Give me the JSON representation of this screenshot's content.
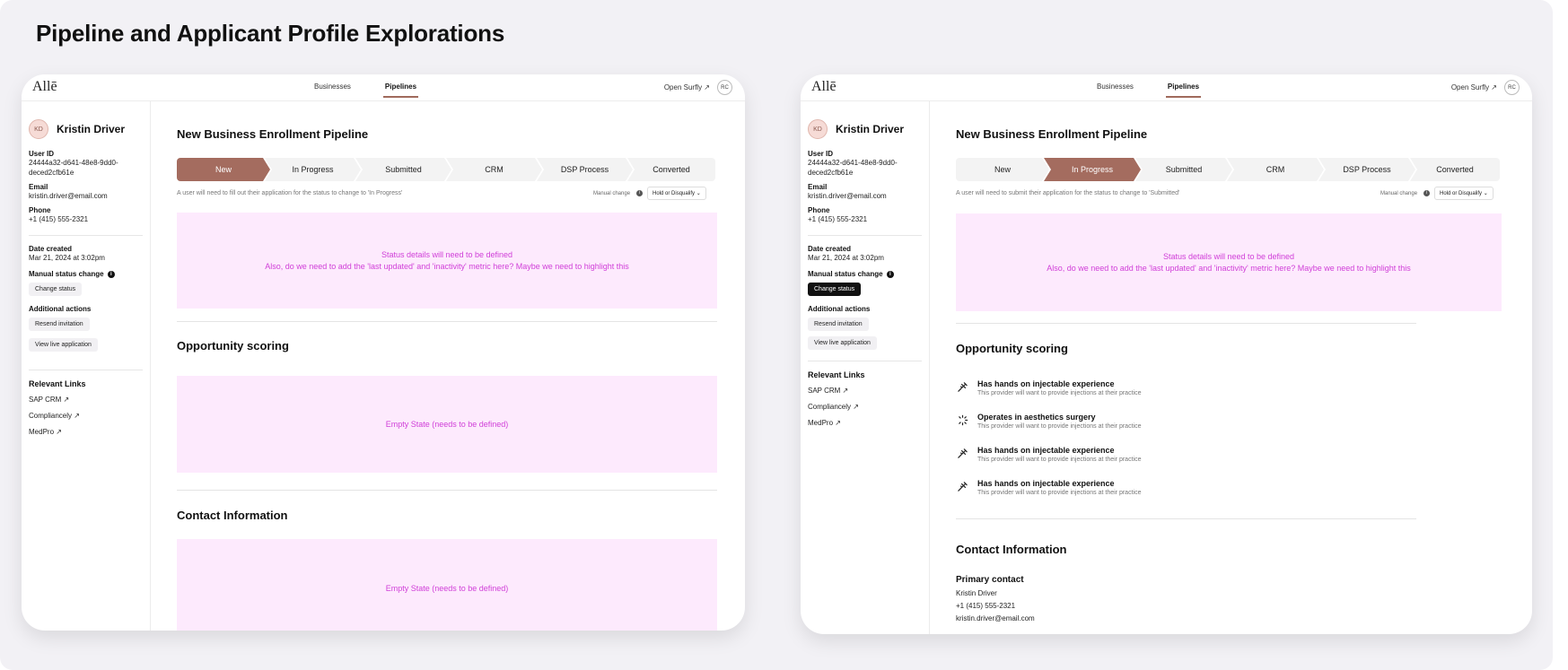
{
  "page_title": "Pipeline and Applicant Profile Explorations",
  "nav": {
    "logo": "Allē",
    "links": [
      "Businesses",
      "Pipelines"
    ],
    "active_link": "Pipelines",
    "open_surfly": "Open Surfly ↗",
    "user_initials": "RC"
  },
  "profile": {
    "initials": "KD",
    "name": "Kristin Driver",
    "user_id_label": "User ID",
    "user_id": "24444a32-d641-48e8-9dd0-deced2cfb61e",
    "email_label": "Email",
    "email": "kristin.driver@email.com",
    "phone_label": "Phone",
    "phone": "+1 (415) 555-2321",
    "date_created_label": "Date created",
    "date_created": "Mar 21, 2024 at 3:02pm",
    "manual_status_label": "Manual status change",
    "change_status": "Change status",
    "additional_actions_label": "Additional actions",
    "resend_invitation": "Resend invitation",
    "view_live_application": "View live application",
    "relevant_links_label": "Relevant Links",
    "links": [
      "SAP CRM ↗",
      "Compliancely ↗",
      "MedPro ↗"
    ]
  },
  "pipeline": {
    "title": "New Business Enrollment Pipeline",
    "steps": [
      "New",
      "In Progress",
      "Submitted",
      "CRM",
      "DSP Process",
      "Converted"
    ],
    "manual_change": "Manual change",
    "hold_select": "Hold or Disqualify",
    "select_chevron": "⌄"
  },
  "variant1": {
    "active_step": "New",
    "hint": "A user will need to fill out their application for the status to change to 'In Progress'",
    "status_placeholder_1": "Status details will need to be defined",
    "status_placeholder_2": "Also, do we need to add the 'last updated' and 'inactivity' metric here? Maybe we need to highlight this",
    "opportunity_title": "Opportunity scoring",
    "opportunity_empty": "Empty State (needs to be defined)",
    "contact_title": "Contact Information",
    "contact_empty": "Empty State (needs to be defined)"
  },
  "variant2": {
    "active_step": "In Progress",
    "hint": "A user will need to submit their application for the status to change to 'Submitted'",
    "status_placeholder_1": "Status details will need to be defined",
    "status_placeholder_2": "Also, do we need to add the 'last updated' and 'inactivity' metric here? Maybe we need to highlight this",
    "opportunity_title": "Opportunity scoring",
    "scores": [
      {
        "icon": "syringe-icon",
        "title": "Has hands on injectable experience",
        "sub": "This provider will want to provide injections at their practice"
      },
      {
        "icon": "loader-icon",
        "title": "Operates in aesthetics surgery",
        "sub": "This provider will want to provide injections at their practice"
      },
      {
        "icon": "syringe-icon",
        "title": "Has hands on injectable experience",
        "sub": "This provider will want to provide injections at their practice"
      },
      {
        "icon": "syringe-icon",
        "title": "Has hands on injectable experience",
        "sub": "This provider will want to provide injections at their practice"
      }
    ],
    "contact_title": "Contact Information",
    "primary_contact_label": "Primary contact",
    "primary_contact_name": "Kristin Driver",
    "primary_contact_phone": "+1 (415) 555-2321",
    "primary_contact_email": "kristin.driver@email.com"
  },
  "colors": {
    "active_step": "#a46c5f",
    "placeholder_bg": "#fdeafd",
    "placeholder_text": "#d03fd8",
    "canvas_bg": "#f2f1f5"
  }
}
